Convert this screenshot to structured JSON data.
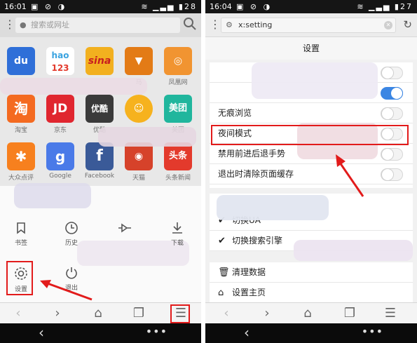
{
  "left": {
    "status": {
      "time": "16:01",
      "battery": "28"
    },
    "search": {
      "placeholder": "搜索或网址"
    },
    "apps": [
      {
        "label": "",
        "icon": "baidu-icon",
        "glyph": "du",
        "color": "#2f6fd8"
      },
      {
        "label": "",
        "icon": "hao123-icon",
        "glyph": "hao",
        "color": "#3aa3e0"
      },
      {
        "label": "",
        "icon": "sina-icon",
        "glyph": "sina",
        "color": "#f2b01f"
      },
      {
        "label": "马",
        "icon": "tmall-head-icon",
        "glyph": "",
        "color": "#e37b16"
      },
      {
        "label": "凤凰网",
        "icon": "ifeng-icon",
        "glyph": "",
        "color": "#f19431"
      },
      {
        "label": "淘宝",
        "icon": "taobao-icon",
        "glyph": "淘",
        "color": "#f46a20"
      },
      {
        "label": "京东",
        "icon": "jd-icon",
        "glyph": "JD",
        "color": "#e0262f"
      },
      {
        "label": "优酷",
        "icon": "youku-icon",
        "glyph": "优酷",
        "color": "#3a3a3a"
      },
      {
        "label": "",
        "icon": "meituan-wm-icon",
        "glyph": "",
        "color": "#f6b21e"
      },
      {
        "label": "美团",
        "icon": "meituan-icon",
        "glyph": "美团",
        "color": "#20b69d"
      },
      {
        "label": "大众点评",
        "icon": "dianping-icon",
        "glyph": "",
        "color": "#f7801e"
      },
      {
        "label": "Google",
        "icon": "google-icon",
        "glyph": "g",
        "color": "#4a7ae8"
      },
      {
        "label": "Facebook",
        "icon": "facebook-icon",
        "glyph": "f",
        "color": "#3a5a98"
      },
      {
        "label": "天猫",
        "icon": "tmall-icon",
        "glyph": "",
        "color": "#d6422a"
      },
      {
        "label": "头条新闻",
        "icon": "toutiao-icon",
        "glyph": "头条",
        "color": "#e33a2c"
      }
    ],
    "menu": {
      "bookmarks": "书签",
      "history": "历史",
      "downloads": "下载",
      "settings": "设置",
      "exit": "退出"
    }
  },
  "right": {
    "status": {
      "time": "16:04",
      "battery": "27"
    },
    "url": "x:setting",
    "title": "设置",
    "settings": [
      {
        "label": "",
        "on": false
      },
      {
        "label": "",
        "on": true
      },
      {
        "label": "无痕浏览",
        "on": false
      },
      {
        "label": "夜间模式",
        "on": false
      },
      {
        "label": "禁用前进后退手势",
        "on": false
      },
      {
        "label": "退出时清除页面缓存",
        "on": false
      }
    ],
    "options": [
      {
        "label": "切换UA"
      },
      {
        "label": "切换搜索引擎"
      }
    ],
    "actions": [
      {
        "label": "清理数据"
      },
      {
        "label": "设置主页"
      }
    ]
  },
  "colors": {
    "highlight": "#e21b1b",
    "accent": "#3b86e3"
  }
}
